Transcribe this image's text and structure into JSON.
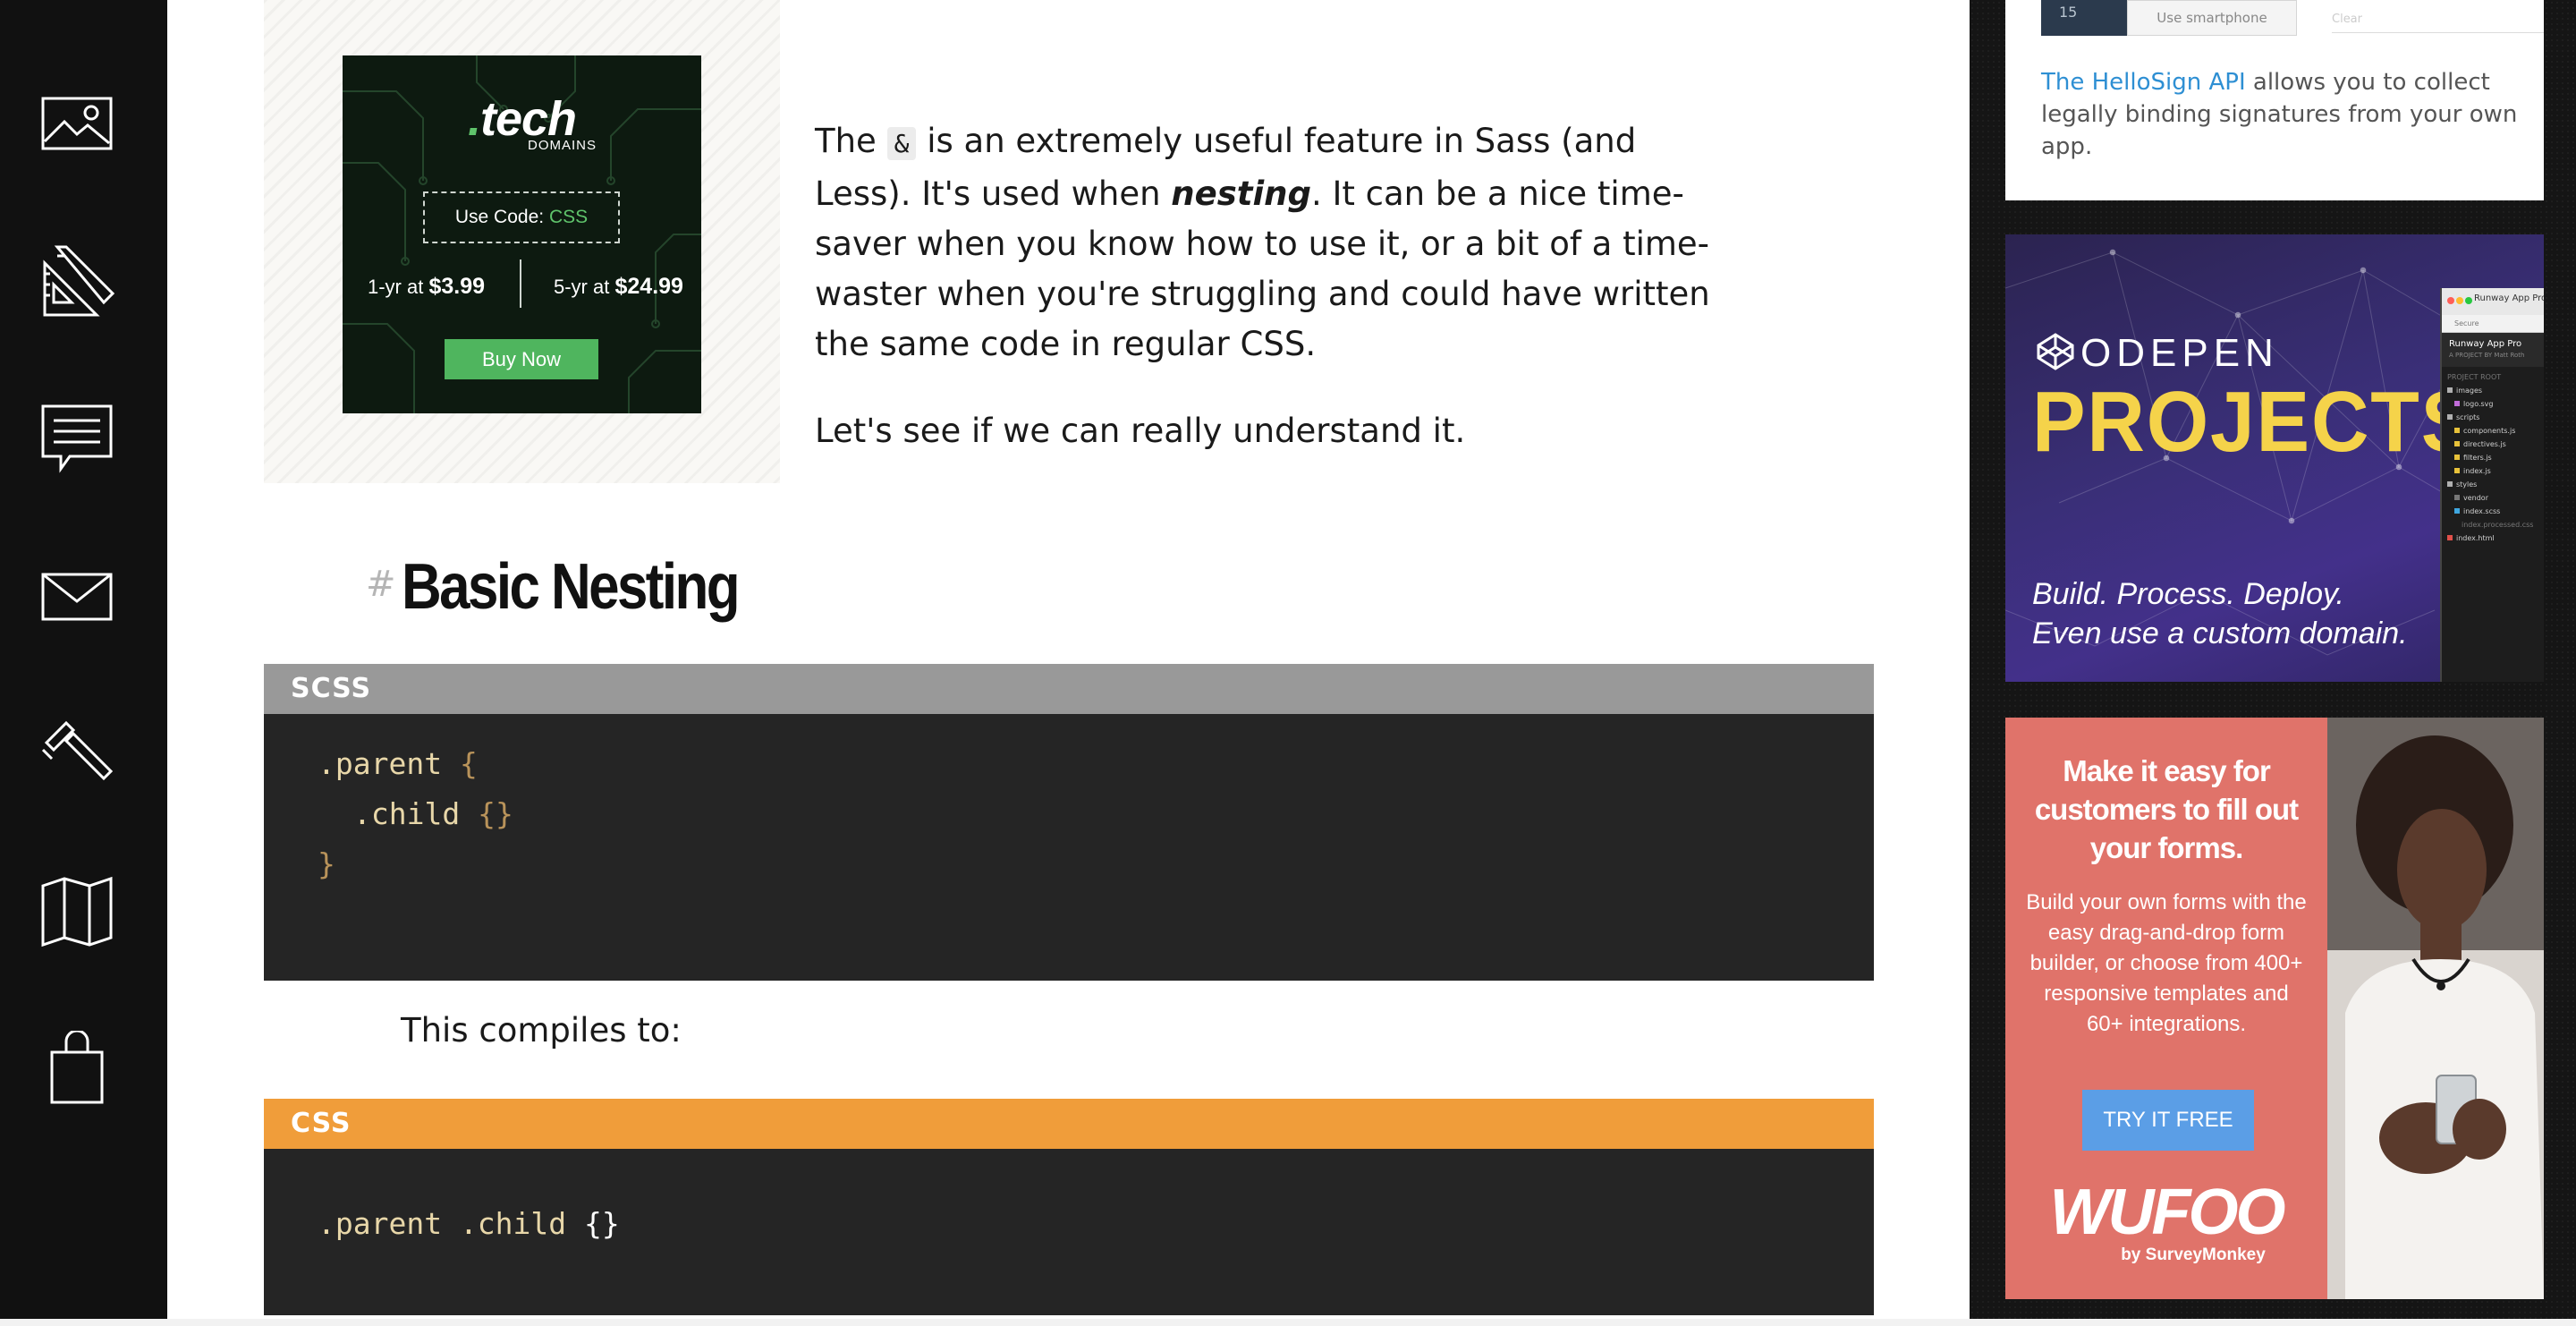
{
  "left_nav": {
    "items": [
      {
        "icon": "image-icon"
      },
      {
        "icon": "design-tools-icon"
      },
      {
        "icon": "chat-icon"
      },
      {
        "icon": "mail-icon"
      },
      {
        "icon": "hammer-icon"
      },
      {
        "icon": "map-icon"
      },
      {
        "icon": "shopping-bag-icon"
      }
    ]
  },
  "ad_tech": {
    "logo": ".tech",
    "subtitle": "DOMAINS",
    "code_label": "Use Code:",
    "code_value": "CSS",
    "price_1yr_label": "1-yr at",
    "price_1yr": "$3.99",
    "price_5yr_label": "5-yr at",
    "price_5yr": "$24.99",
    "button": "Buy Now"
  },
  "article": {
    "intro_before_code": "The ",
    "intro_code": "&",
    "intro_after_code": " is an extremely useful feature in Sass (and Less). It's used when ",
    "intro_em": "nesting",
    "intro_end": ". It can be a nice time-saver when you know how to use it, or a bit of a time-waster when you're struggling and could have written the same code in regular CSS.",
    "intro2": "Let's see if we can really understand it.",
    "heading_hash": "#",
    "heading": "Basic Nesting",
    "code1": {
      "lang": "SCSS",
      "line1_sel": ".parent",
      "line1_brace": "{",
      "line2_sel": ".child",
      "line2_brace": "{}",
      "line3_brace": "}"
    },
    "compiles_text": "This compiles to:",
    "code2": {
      "lang": "CSS",
      "line1_sel": ".parent .child",
      "line1_brace": "{}"
    }
  },
  "sidebar": {
    "hellosign": {
      "phone_number": "15",
      "phone_button": "Use smartphone",
      "clear": "Clear",
      "link": "The HelloSign API",
      "text": " allows you to collect legally binding signatures from your own app."
    },
    "codepen": {
      "logo": "CODEPEN",
      "headline": "PROJECTS",
      "tagline_1": "Build. Process. Deploy.",
      "tagline_2": "Even use a custom domain.",
      "window_title": "Runway App Pro",
      "window_url": "Secure",
      "window_project": "A PROJECT BY Matt Roth",
      "window_label": "PROJECT ROOT",
      "files": [
        "images",
        "logo.svg",
        "scripts",
        "components.js",
        "directives.js",
        "filters.js",
        "index.js",
        "styles",
        "vendor",
        "index.scss",
        "index.processed.css",
        "index.html"
      ]
    },
    "wufoo": {
      "headline": "Make it easy for customers to fill out your forms.",
      "body": "Build your own forms with the easy drag-and-drop form builder, or choose from 400+ responsive templates and 60+ integrations.",
      "button": "TRY IT FREE",
      "logo": "WUFOO",
      "byline": "by SurveyMonkey"
    }
  },
  "colors": {
    "nav_bg": "#111111",
    "scss_header": "#999999",
    "css_header": "#f09d3a",
    "code_bg": "#252525",
    "link": "#2e8fd3",
    "wufoo_bg": "#e0736a",
    "codepen_yellow": "#f5d34a"
  }
}
